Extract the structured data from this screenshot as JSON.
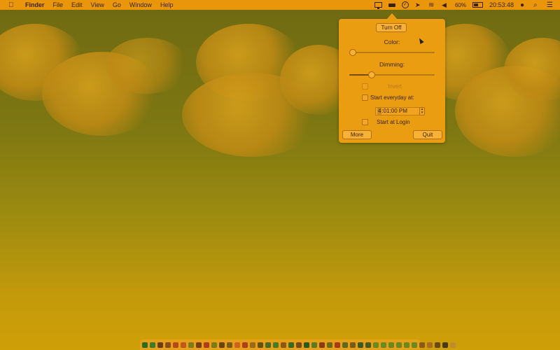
{
  "menubar": {
    "apple_icon": "apple-icon",
    "items": [
      "Finder",
      "File",
      "Edit",
      "View",
      "Go",
      "Window",
      "Help"
    ],
    "battery_percent": "60%",
    "clock": "20:53:48"
  },
  "popover": {
    "turn_off_label": "Turn Off",
    "color_label": "Color:",
    "color_value": 0.0,
    "dimming_label": "Dimming:",
    "dimming_value": 0.24,
    "invert_label": "Invert",
    "start_everyday_label": "Start everyday at:",
    "time_hour": "4",
    "time_rest": ":01:00 PM",
    "start_login_label": "Start at Login",
    "more_label": "More",
    "quit_label": "Quit"
  },
  "colors": {
    "menubar": "#e9960a",
    "popover": "#eb9d12",
    "desktop_top": "#6f6a12",
    "desktop_bottom": "#cf9f08"
  },
  "dock": {
    "icons": [
      "#2e6b1d",
      "#3f7a2a",
      "#6b3d10",
      "#8a4d13",
      "#b44a1a",
      "#c0561a",
      "#7b7d1c",
      "#7a3f14",
      "#b03a1a",
      "#7a7a16",
      "#6a4410",
      "#7a5a14",
      "#d0621d",
      "#b0401a",
      "#9a6a18",
      "#6a5010",
      "#4a6b22",
      "#4a7a24",
      "#8a5a14",
      "#3a6a20",
      "#7a4a14",
      "#2a5a1a",
      "#5a7a26",
      "#8a3a14",
      "#6a6a18",
      "#a83a1a",
      "#5a6a20",
      "#7a5a18",
      "#3a5a20",
      "#4a5a1a",
      "#6a8a20",
      "#6a8a20",
      "#6a8a20",
      "#6a8a20",
      "#6a8a20",
      "#6a8a20",
      "#8a5a18",
      "#aa6a20",
      "#6a4a14",
      "#4a3a10",
      "#c08a30"
    ]
  }
}
